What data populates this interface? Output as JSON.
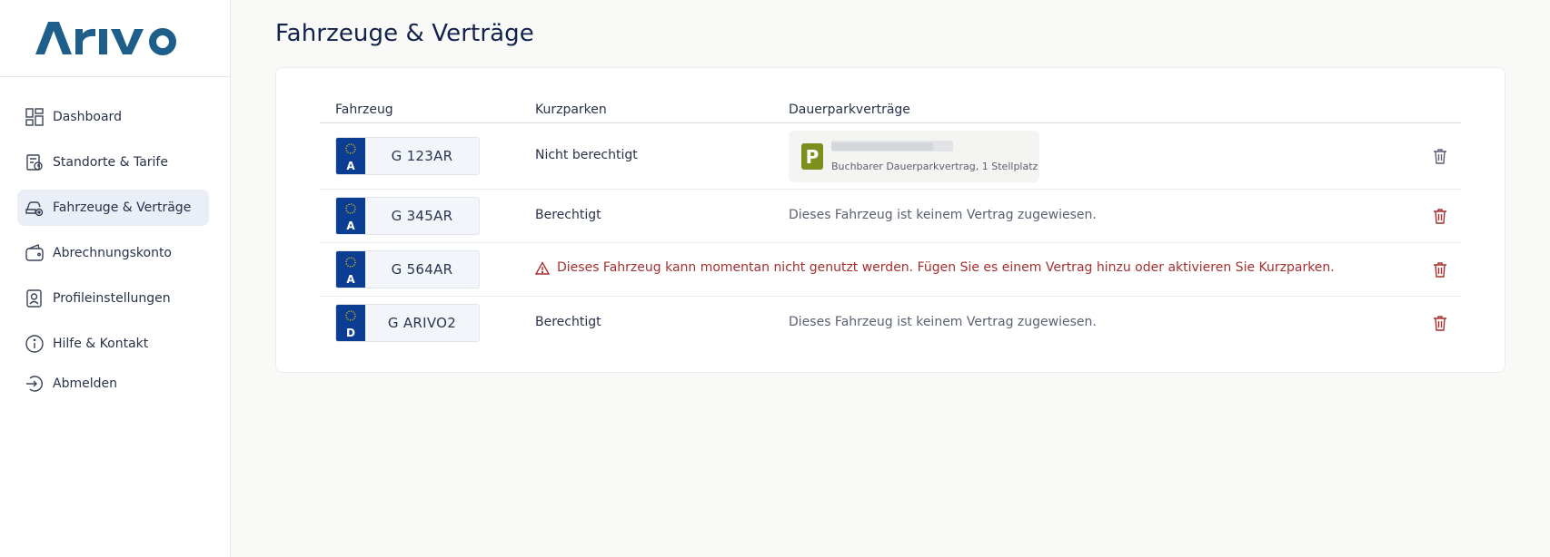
{
  "app": {
    "logo_text": "ARIVO",
    "brand_color": "#1d5e8a"
  },
  "sidebar": {
    "items": [
      {
        "label": "Dashboard",
        "icon": "dashboard-icon"
      },
      {
        "label": "Standorte & Tarife",
        "icon": "location-tariff-icon"
      },
      {
        "label": "Fahrzeuge & Verträge",
        "icon": "car-settings-icon",
        "active": true
      },
      {
        "label": "Abrechnungskonto",
        "icon": "wallet-icon"
      },
      {
        "label": "Profileinstellungen",
        "icon": "profile-icon"
      },
      {
        "label": "Hilfe & Kontakt",
        "icon": "info-icon"
      },
      {
        "label": "Abmelden",
        "icon": "logout-icon"
      }
    ]
  },
  "page": {
    "title": "Fahrzeuge & Verträge"
  },
  "table": {
    "headers": {
      "vehicle": "Fahrzeug",
      "short_parking": "Kurzparken",
      "contracts": "Dauerparkverträge"
    },
    "rows": [
      {
        "country": "A",
        "plate": "G 123AR",
        "short_parking": "Nicht berechtigt",
        "contract_badge": "P",
        "contract_sub": "Buchbarer Dauerparkvertrag, 1 Stellplatz",
        "trash_color": "#5b6172"
      },
      {
        "country": "A",
        "plate": "G 345AR",
        "short_parking": "Berechtigt",
        "contract_text": "Dieses Fahrzeug ist keinem Vertrag zugewiesen.",
        "trash_color": "#a72f2f"
      },
      {
        "country": "A",
        "plate": "G 564AR",
        "warning": "Dieses Fahrzeug kann momentan nicht genutzt werden. Fügen Sie es einem Vertrag hinzu oder aktivieren Sie Kurzparken.",
        "trash_color": "#a72f2f"
      },
      {
        "country": "D",
        "plate": "G ARIVO2",
        "short_parking": "Berechtigt",
        "contract_text": "Dieses Fahrzeug ist keinem Vertrag zugewiesen.",
        "trash_color": "#a72f2f"
      }
    ]
  },
  "colors": {
    "warning": "#a72f2f",
    "active_nav": "#e9eef7",
    "plate_blue": "#0b3e93",
    "parking_badge": "#7e8e1d"
  }
}
